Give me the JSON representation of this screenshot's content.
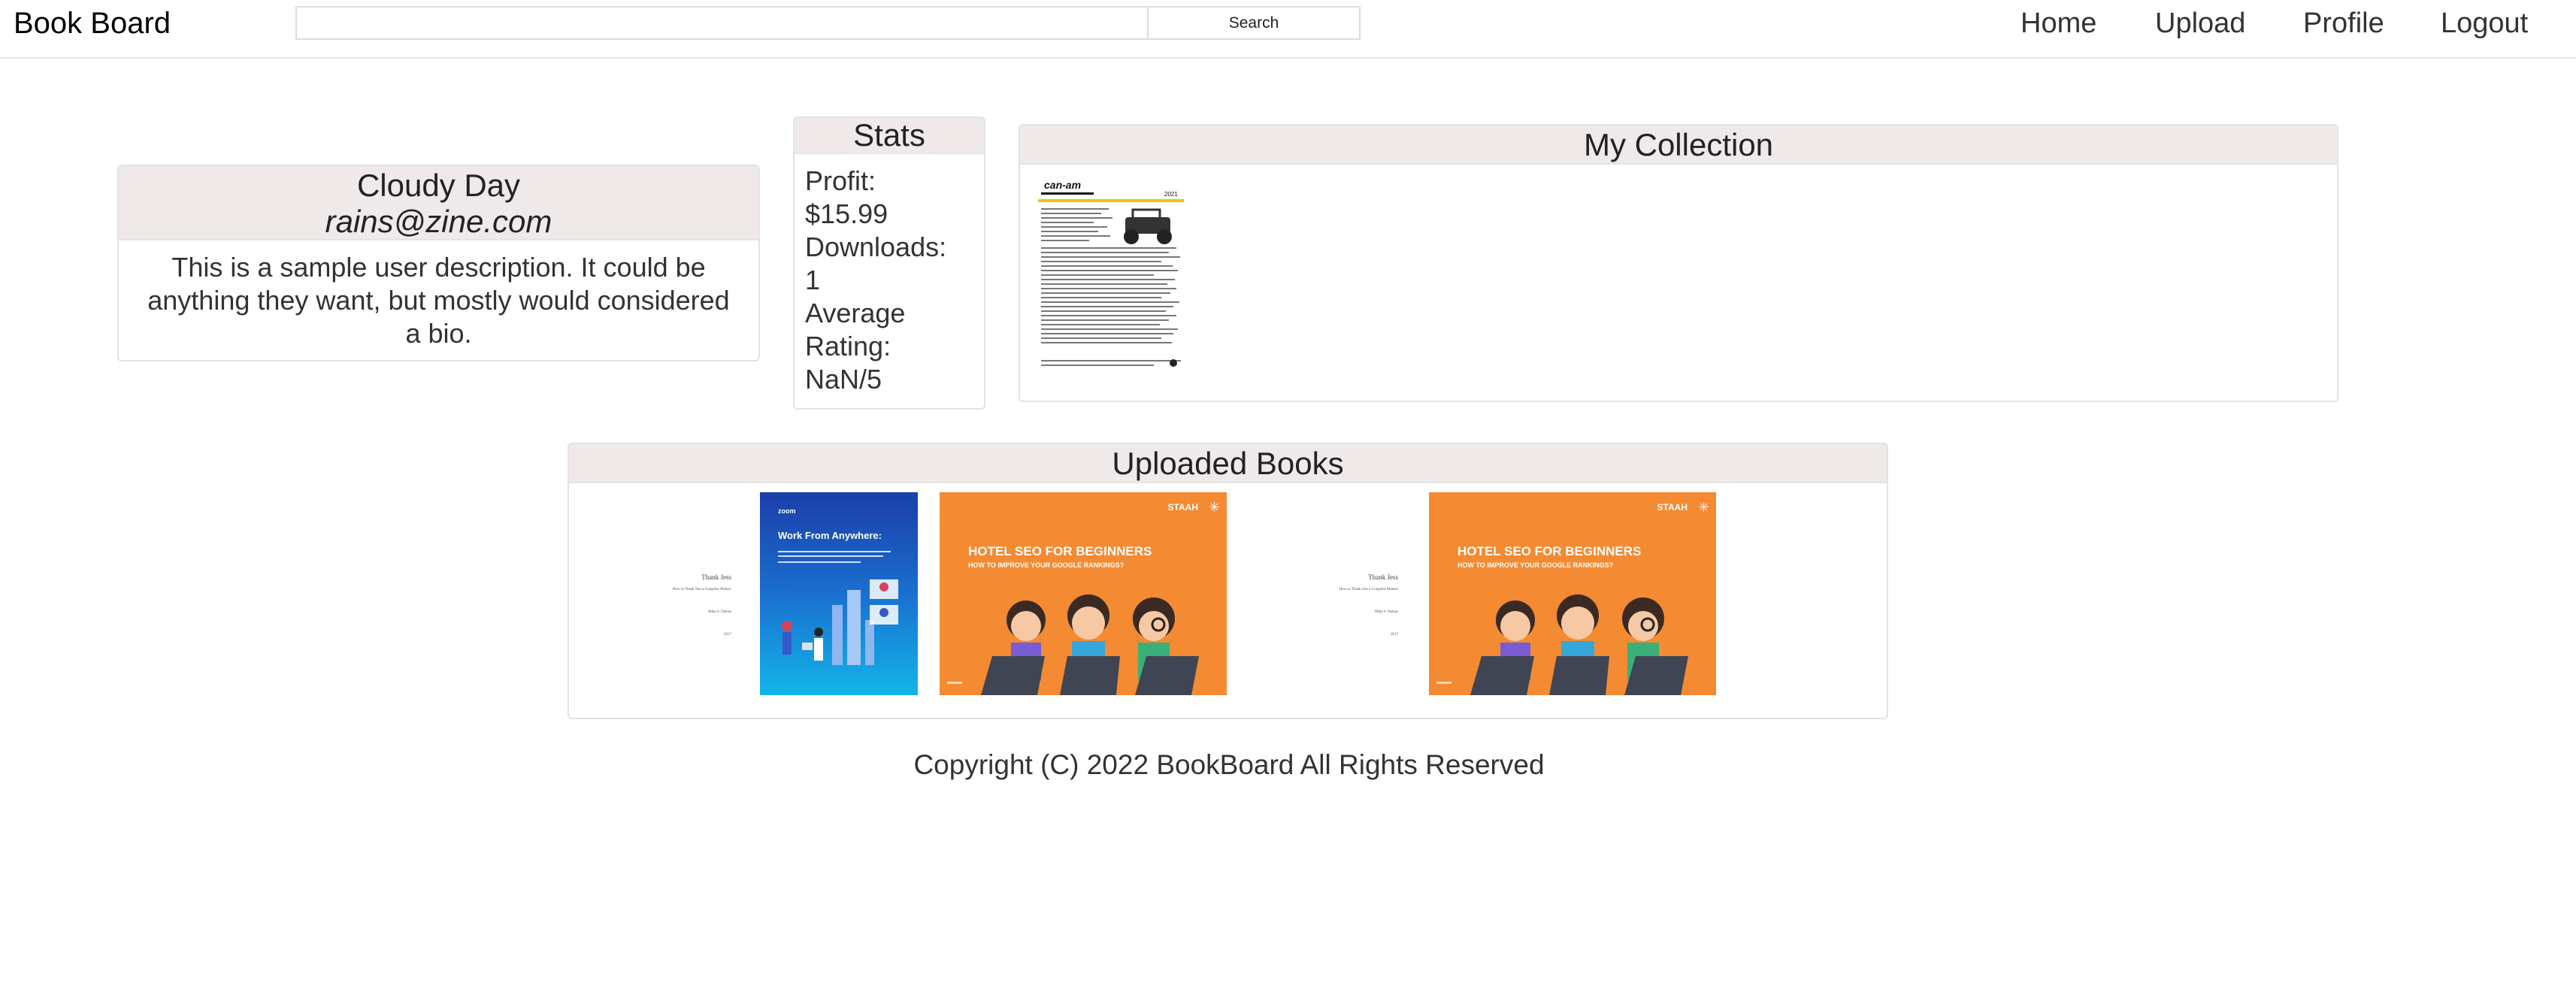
{
  "nav": {
    "brand": "Book Board",
    "search_placeholder": "",
    "search_button": "Search",
    "links": [
      "Home",
      "Upload",
      "Profile",
      "Logout"
    ]
  },
  "profile": {
    "name": "Cloudy Day",
    "email": "rains@zine.com",
    "bio": "This is a sample user description. It could be anything they want, but mostly would considered a bio."
  },
  "stats": {
    "title": "Stats",
    "lines": [
      "Profit:",
      "$15.99",
      "Downloads:",
      "1",
      "Average",
      "Rating:",
      "NaN/5"
    ]
  },
  "collection": {
    "title": "My Collection",
    "books": [
      {
        "kind": "spec-sheet",
        "brand_text": "can-am",
        "year_text": "2021"
      }
    ]
  },
  "uploads": {
    "title": "Uploaded Books",
    "books": [
      {
        "kind": "text-cover",
        "lines": [
          "Thank Jess",
          "How to Thank Jess a Craigslist Maniac",
          "Mike S. Damas",
          "2017"
        ]
      },
      {
        "kind": "blue-cover",
        "logo": "zoom",
        "title": "Work From Anywhere:"
      },
      {
        "kind": "orange-cover",
        "logo": "STAAH",
        "title": "HOTEL SEO FOR BEGINNERS",
        "subtitle": "HOW TO IMPROVE YOUR GOOGLE RANKINGS?"
      },
      {
        "kind": "text-cover",
        "lines": [
          "Thank Jess",
          "How to Thank Jess a Craigslist Maniac",
          "Mike S. Damas",
          "2017"
        ]
      },
      {
        "kind": "orange-cover",
        "logo": "STAAH",
        "title": "HOTEL SEO FOR BEGINNERS",
        "subtitle": "HOW TO IMPROVE YOUR GOOGLE RANKINGS?"
      }
    ]
  },
  "footer": "Copyright (C) 2022 BookBoard All Rights Reserved",
  "colors": {
    "panel_header": "#efe9e9",
    "orange_cover": "#f48a32",
    "blue_cover": "#1a5fd0"
  }
}
